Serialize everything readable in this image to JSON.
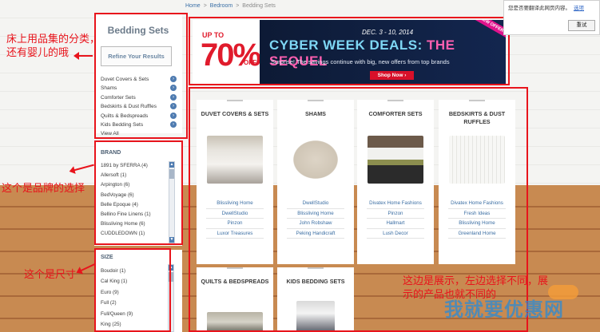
{
  "breadcrumb": {
    "home": "Home",
    "level1": "Bedroom",
    "current": "Bedding Sets",
    "sep": ">"
  },
  "sidebar": {
    "title": "Bedding Sets",
    "refine_label": "Refine Your Results",
    "categories": [
      "Duvet Covers & Sets",
      "Shams",
      "Comforter Sets",
      "Bedskirts & Dust Ruffles",
      "Quilts & Bedspreads",
      "Kids Bedding Sets",
      "View All"
    ],
    "arrow": "›"
  },
  "brand": {
    "heading": "BRAND",
    "items": [
      "1891 by SFERRA (4)",
      "Allersoft (1)",
      "Arpington (6)",
      "BedVoyage (6)",
      "Belle Epoque (4)",
      "Bellino Fine Linens (1)",
      "Blissliving Home (6)",
      "CUDDLEDOWN (1)"
    ]
  },
  "size": {
    "heading": "SIZE",
    "items": [
      "Boudoir (1)",
      "Cal King (1)",
      "Euro (9)",
      "Full (2)",
      "Full/Queen (9)",
      "King (25)"
    ]
  },
  "scroll": {
    "up": "▲",
    "down": "▼"
  },
  "banner": {
    "up_to": "UP TO",
    "percent": "70%",
    "off": "OFF*",
    "dates": "DEC. 3 - 10, 2014",
    "headline_a": "CYBER WEEK DEALS: ",
    "headline_b": "THE SEQUEL",
    "subline": "Surprise! The savings continue with big, new offers from top brands",
    "shop_now": "Shop Now ›",
    "new_offers": "NEW OFFERS"
  },
  "cards": [
    {
      "title": "DUVET COVERS & SETS",
      "links": [
        "Blissliving Home",
        "DwellStudio",
        "Pinzon",
        "Luxor Treasures"
      ]
    },
    {
      "title": "SHAMS",
      "links": [
        "DwellStudio",
        "Blissliving Home",
        "John Robshaw",
        "Peking Handicraft"
      ]
    },
    {
      "title": "COMFORTER SETS",
      "links": [
        "Divatex Home Fashions",
        "Pinzon",
        "Hallmart",
        "Lush Decor"
      ]
    },
    {
      "title": "BEDSKIRTS & DUST RUFFLES",
      "links": [
        "Divatex Home Fashions",
        "Fresh Ideas",
        "Blissliving Home",
        "Greenland Home"
      ]
    },
    {
      "title": "QUILTS & BEDSPREADS",
      "links": []
    },
    {
      "title": "KIDS BEDDING SETS",
      "links": []
    }
  ],
  "annotations": {
    "category_note": "床上用品集的分类，\n还有婴儿的哦",
    "brand_note": "这个是品牌的选择",
    "size_note": "这个是尺寸",
    "display_note": "这边是展示，左边选择不同，展\n示的产品也就不同的"
  },
  "translate_popup": {
    "message": "您是否要翻译此网页内容。",
    "option": "选项",
    "button": "重试"
  },
  "watermark": "我就要优惠网",
  "colors": {
    "annotation_red": "#e8141c",
    "link_blue": "#3b6ea3",
    "banner_red": "#e01b2c",
    "banner_navy": "#0d1a35"
  }
}
